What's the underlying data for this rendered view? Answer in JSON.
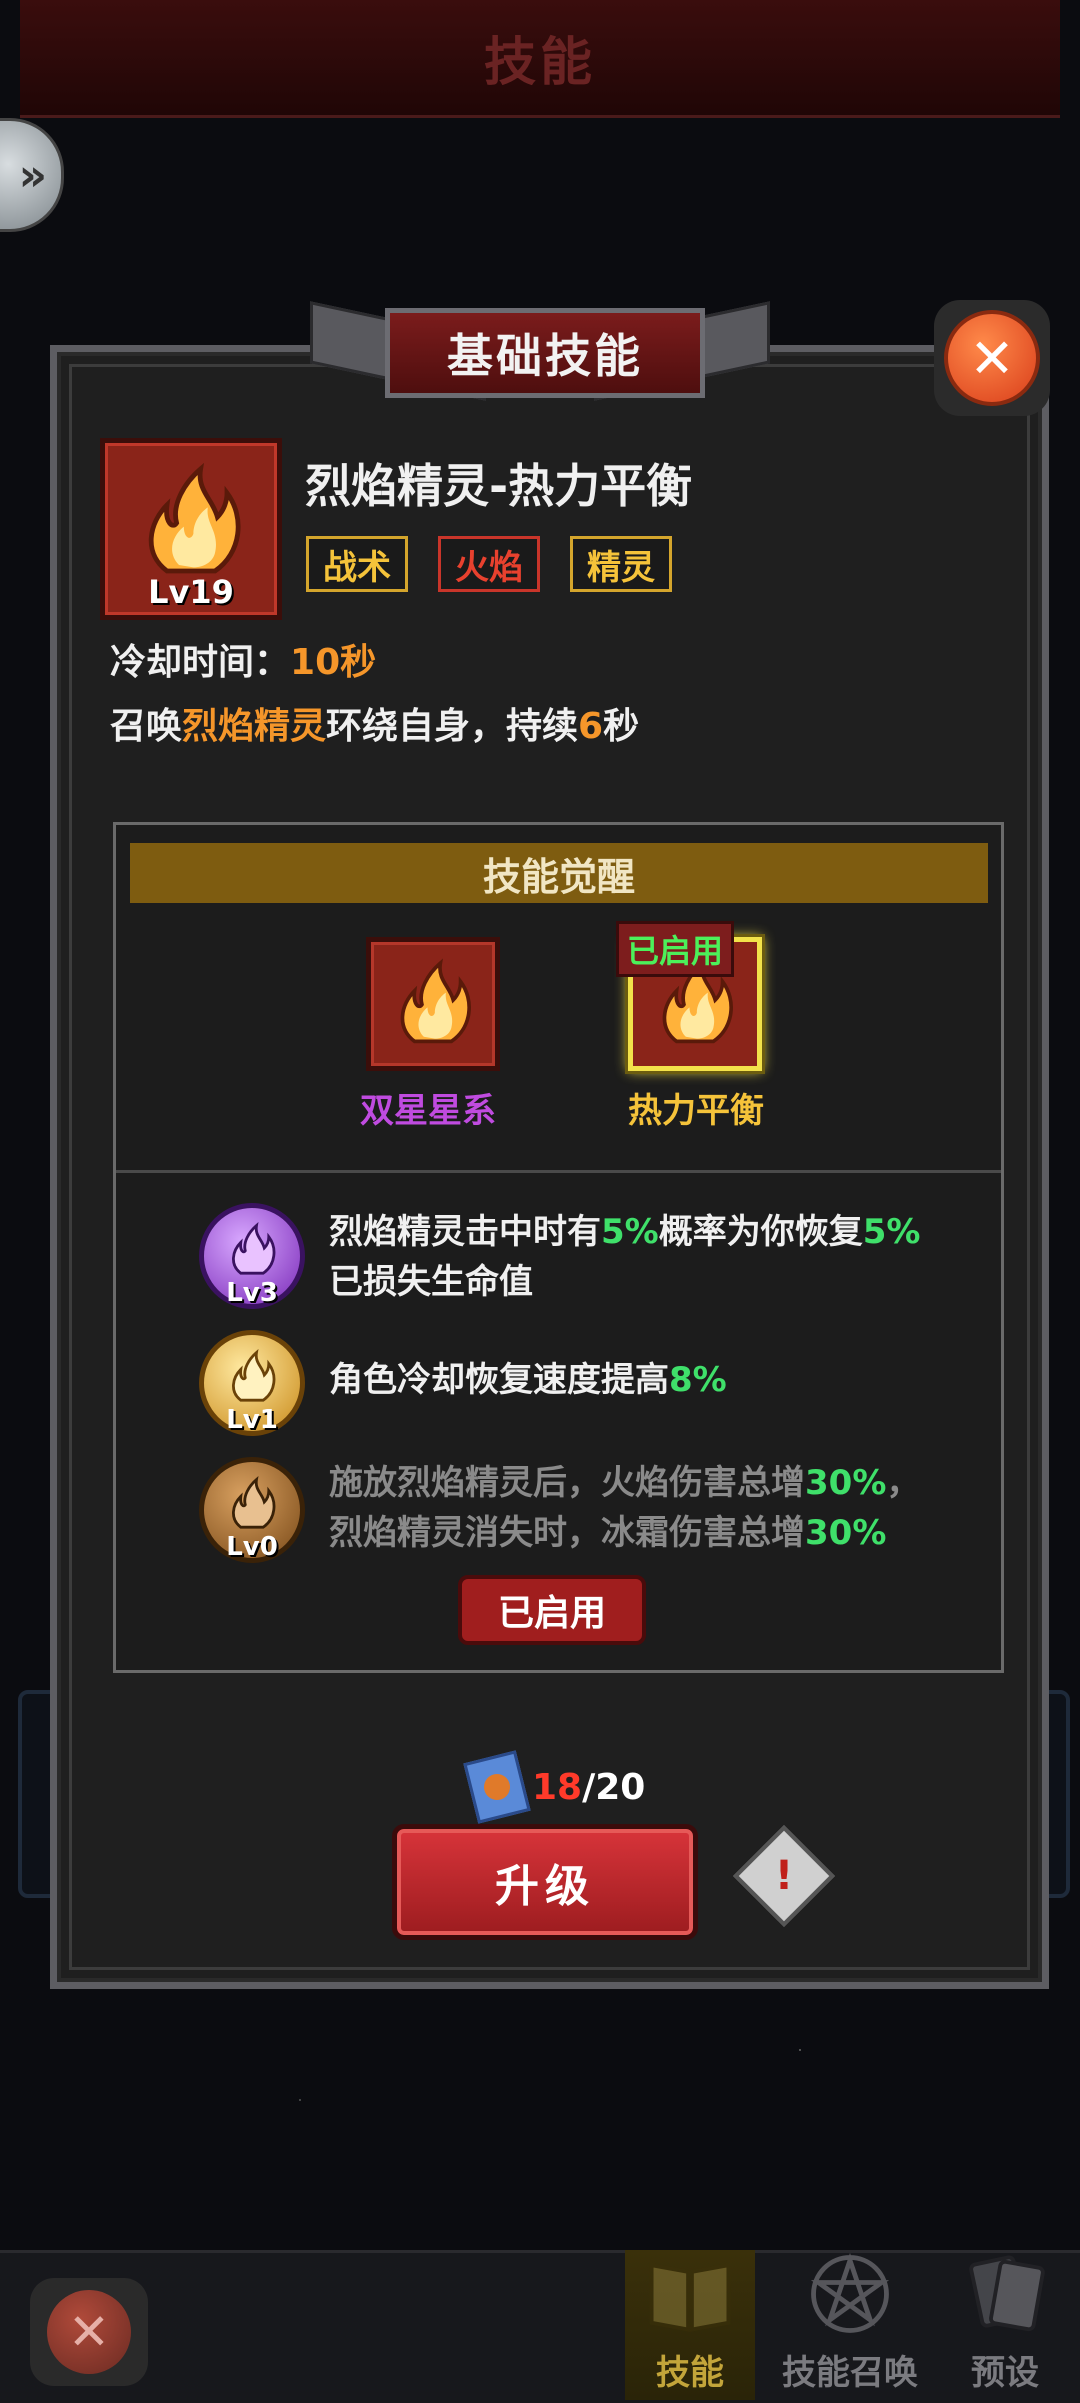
{
  "header": {
    "title": "技能"
  },
  "dialog": {
    "title": "基础技能",
    "skill": {
      "name": "烈焰精灵-热力平衡",
      "level": "Lv19",
      "tags": [
        "战术",
        "火焰",
        "精灵"
      ],
      "cooldown_label": "冷却时间：",
      "cooldown_value": "10秒",
      "desc_prefix": "召唤",
      "desc_highlight": "烈焰精灵",
      "desc_middle": "环绕自身，持续",
      "desc_duration": "6",
      "desc_suffix": "秒"
    },
    "awakening": {
      "title": "技能觉醒",
      "options": [
        {
          "label": "双星星系",
          "color": "#c04be0"
        },
        {
          "label": "热力平衡",
          "color": "#f5c33a",
          "status": "已启用"
        }
      ],
      "effects": [
        {
          "level": "Lv3",
          "text_a": "烈焰精灵击中时有",
          "val_a": "5%",
          "text_b": "概率为你恢复",
          "val_b": "5%",
          "text_c": "已损失生命值"
        },
        {
          "level": "Lv1",
          "text_a": "角色冷却恢复速度提高",
          "val_a": "8%"
        },
        {
          "level": "Lv0",
          "text_a": "施放烈焰精灵后，火焰伤害总增",
          "val_a": "30%",
          "text_a2": "，",
          "text_b": "烈焰精灵消失时，冰霜伤害总增",
          "val_b": "30%"
        }
      ],
      "status_button": "已启用"
    },
    "cost": {
      "current": "18",
      "total": "/20"
    },
    "upgrade_button": "升级",
    "info_icon": "!"
  },
  "bottom_nav": {
    "items": [
      {
        "label": "技能",
        "icon": "book-icon",
        "active": true
      },
      {
        "label": "技能召唤",
        "icon": "pentagram-icon",
        "active": false
      },
      {
        "label": "预设",
        "icon": "cards-icon",
        "active": false
      }
    ]
  },
  "colors": {
    "accent_red": "#a01e1e",
    "gold_band": "#7e5c10",
    "highlight_green": "#3fe06a",
    "highlight_orange": "#f5962a"
  }
}
